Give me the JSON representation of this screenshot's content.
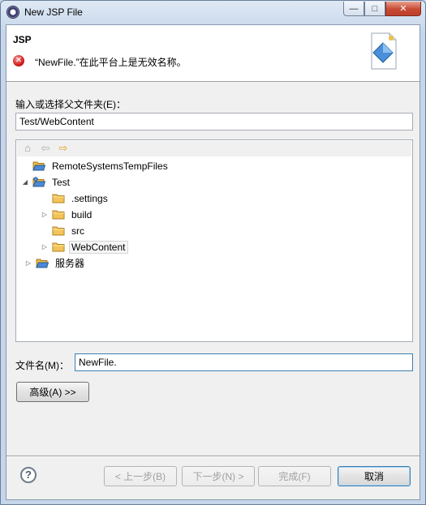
{
  "window": {
    "title": "New JSP File",
    "minimize_symbol": "—",
    "maximize_symbol": "□",
    "close_symbol": "✕"
  },
  "header": {
    "title": "JSP",
    "error_message": "“NewFile.”在此平台上是无效名称。",
    "error_icon_glyph": "✕"
  },
  "parent_folder": {
    "label": "输入或选择父文件夹(E)：",
    "value": "Test/WebContent"
  },
  "tree_toolbar": {
    "home_icon": "⌂",
    "back_icon": "⇦",
    "forward_icon": "⇨"
  },
  "tree": {
    "items": [
      {
        "label": "RemoteSystemsTempFiles",
        "twisty": "",
        "icon": "open-folder-icon"
      },
      {
        "label": "Test",
        "twisty": "◢",
        "icon": "project-icon"
      },
      {
        "label": ".settings",
        "twisty": "",
        "icon": "folder-icon"
      },
      {
        "label": "build",
        "twisty": "▷",
        "icon": "folder-icon"
      },
      {
        "label": "src",
        "twisty": "",
        "icon": "folder-icon"
      },
      {
        "label": "WebContent",
        "twisty": "▷",
        "icon": "folder-icon"
      },
      {
        "label": "服务器",
        "twisty": "▷",
        "icon": "open-folder-icon"
      }
    ]
  },
  "file_name": {
    "label": "文件名(M)：",
    "value": "NewFile."
  },
  "advanced_button": "高级(A) >>",
  "footer": {
    "help_glyph": "?",
    "back": "< 上一步(B)",
    "next": "下一步(N) >",
    "finish": "完成(F)",
    "cancel": "取消"
  },
  "colors": {
    "folder": "#e8b84a",
    "error": "#d11b1b",
    "accent": "#3c7fb1"
  }
}
